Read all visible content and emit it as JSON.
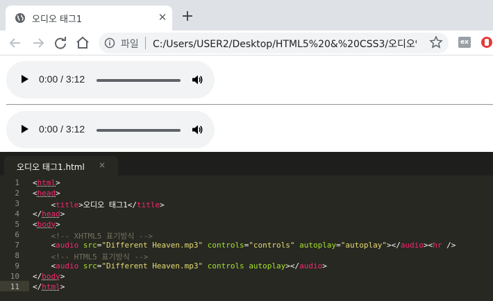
{
  "browser": {
    "tab_title": "오디오 태그1",
    "tab_close": "✕",
    "new_tab": "+",
    "address_scheme": "파일",
    "address_url": "C:/Users/USER2/Desktop/HTML5%20&%20CSS3/오디오%2..."
  },
  "page": {
    "players": [
      {
        "time": "0:00 / 3:12"
      },
      {
        "time": "0:00 / 3:12"
      }
    ]
  },
  "editor": {
    "tab_title": "오디오 태그1.html",
    "tab_close": "×",
    "line_numbers": [
      "1",
      "2",
      "3",
      "4",
      "5",
      "6",
      "7",
      "8",
      "9",
      "10",
      "11"
    ],
    "lines": [
      "<html>",
      "<head>",
      "    <title>오디오 태그1</title>",
      "</head>",
      "<body>",
      "    <!-- XHTML5 표기방식 -->",
      "    <audio src=\"Different Heaven.mp3\" controls=\"controls\" autoplay=\"autoplay\"></audio><hr />",
      "    <!-- HTML5 표기방식 -->",
      "    <audio src=\"Different Heaven.mp3\" controls autoplay></audio>",
      "</body>",
      "</html>"
    ]
  },
  "colors": {
    "editor_bg": "#272822",
    "tag": "#f92672",
    "attribute": "#a6e22e",
    "string": "#e6db74",
    "comment": "#75715e"
  },
  "icons": [
    "globe-icon",
    "back-icon",
    "forward-icon",
    "reload-icon",
    "home-icon",
    "info-icon",
    "star-icon",
    "play-icon",
    "volume-icon"
  ]
}
